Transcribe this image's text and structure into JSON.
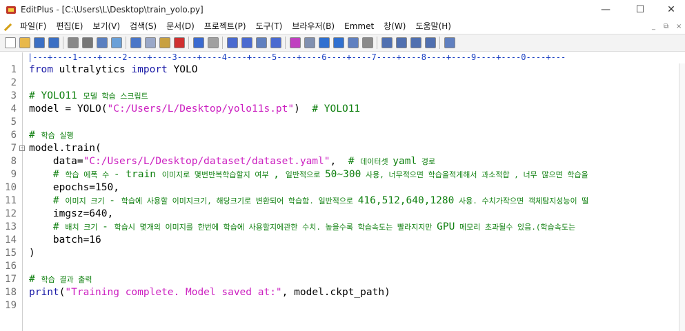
{
  "window": {
    "title": "EditPlus - [C:\\Users\\L\\Desktop\\train_yolo.py]",
    "minimize": "—",
    "maximize": "☐",
    "close": "✕"
  },
  "menu": {
    "items": [
      "파일(F)",
      "편집(E)",
      "보기(V)",
      "검색(S)",
      "문서(D)",
      "프로젝트(P)",
      "도구(T)",
      "브라우저(B)",
      "Emmet",
      "창(W)",
      "도움말(H)"
    ],
    "doc_min": "_",
    "doc_restore": "⧉",
    "doc_close": "×"
  },
  "toolbar": {
    "icons": [
      "new-file-icon",
      "open-folder-icon",
      "save-icon",
      "save-all-icon",
      "print-preview-icon",
      "print-icon",
      "spellcheck-icon",
      "browser-icon",
      "cut-icon",
      "copy-icon",
      "paste-icon",
      "delete-icon",
      "undo-icon",
      "redo-icon",
      "find-icon",
      "replace-icon",
      "goto-icon",
      "indent-icon",
      "font-icon",
      "hex-icon",
      "wordwrap-icon",
      "line-number-icon",
      "column-icon",
      "settings-icon",
      "window-tile-icon",
      "window-cascade-icon",
      "window-split-icon",
      "window-full-icon",
      "help-icon"
    ]
  },
  "ruler": "|---+----1----+----2----+----3----+----4----+----5----+----6----+----7----+----8----+----9----+----0----+---",
  "colors": {
    "keyword": "#1a1aa6",
    "string": "#cc20c0",
    "comment": "#108010",
    "ruler": "#1a3fc2"
  },
  "lines": [
    {
      "n": "1",
      "tokens": [
        {
          "t": "from",
          "c": "kw"
        },
        {
          "t": " ultralytics ",
          "c": "id"
        },
        {
          "t": "import",
          "c": "kw"
        },
        {
          "t": " YOLO",
          "c": "id"
        }
      ]
    },
    {
      "n": "2",
      "tokens": []
    },
    {
      "n": "3",
      "tokens": [
        {
          "t": "# YOLO11 ",
          "c": "cm"
        },
        {
          "t": "모델 학습 스크립트",
          "c": "cm cm-k"
        }
      ]
    },
    {
      "n": "4",
      "tokens": [
        {
          "t": "model = YOLO(",
          "c": "id"
        },
        {
          "t": "\"C:/Users/L/Desktop/yolo11s.pt\"",
          "c": "str"
        },
        {
          "t": ")  ",
          "c": "id"
        },
        {
          "t": "# YOLO11",
          "c": "cm"
        }
      ]
    },
    {
      "n": "5",
      "tokens": []
    },
    {
      "n": "6",
      "tokens": [
        {
          "t": "# ",
          "c": "cm"
        },
        {
          "t": "학습 실행",
          "c": "cm cm-k"
        }
      ]
    },
    {
      "n": "7",
      "fold": true,
      "tokens": [
        {
          "t": "model.train(",
          "c": "id"
        }
      ]
    },
    {
      "n": "8",
      "tokens": [
        {
          "t": "    data=",
          "c": "id"
        },
        {
          "t": "\"C:/Users/L/Desktop/dataset/dataset.yaml\"",
          "c": "str"
        },
        {
          "t": ",  ",
          "c": "id"
        },
        {
          "t": "# ",
          "c": "cm"
        },
        {
          "t": "데이터셋 ",
          "c": "cm cm-k"
        },
        {
          "t": "yaml",
          "c": "cm"
        },
        {
          "t": " 경로",
          "c": "cm cm-k"
        }
      ]
    },
    {
      "n": "9",
      "tokens": [
        {
          "t": "    # ",
          "c": "cm"
        },
        {
          "t": "학습 에폭 수 ",
          "c": "cm cm-k"
        },
        {
          "t": "- train ",
          "c": "cm"
        },
        {
          "t": "이미지로 몇번반복학습할지 여부 ",
          "c": "cm cm-k"
        },
        {
          "t": ", ",
          "c": "cm"
        },
        {
          "t": "일반적으로 ",
          "c": "cm cm-k"
        },
        {
          "t": "50~300",
          "c": "cm"
        },
        {
          "t": " 사용, 너무적으면 학습을적게해서 과소적합 , 너무 많으면 학습을",
          "c": "cm cm-k"
        }
      ]
    },
    {
      "n": "10",
      "tokens": [
        {
          "t": "    epochs=150,",
          "c": "id"
        }
      ]
    },
    {
      "n": "11",
      "tokens": [
        {
          "t": "    # ",
          "c": "cm"
        },
        {
          "t": "이미지 크기 ",
          "c": "cm cm-k"
        },
        {
          "t": "- ",
          "c": "cm"
        },
        {
          "t": "학습에 사용할 이미지크기, 해당크기로 변환되어 학습함. 일반적으로 ",
          "c": "cm cm-k"
        },
        {
          "t": "416,512,640,1280",
          "c": "cm"
        },
        {
          "t": " 사용. 수치가작으면 객체탐지성능이 떨",
          "c": "cm cm-k"
        }
      ]
    },
    {
      "n": "12",
      "tokens": [
        {
          "t": "    imgsz=640,",
          "c": "id"
        }
      ]
    },
    {
      "n": "13",
      "tokens": [
        {
          "t": "    # ",
          "c": "cm"
        },
        {
          "t": "배치 크기 ",
          "c": "cm cm-k"
        },
        {
          "t": "- ",
          "c": "cm"
        },
        {
          "t": "학습시 몇개의 이미지를 한번에 학습에 사용할지에관한 수치. 높을수록 학습속도는 빨라지지만 ",
          "c": "cm cm-k"
        },
        {
          "t": "GPU",
          "c": "cm"
        },
        {
          "t": " 메모리 초과될수 있음.(학습속도는",
          "c": "cm cm-k"
        }
      ]
    },
    {
      "n": "14",
      "tokens": [
        {
          "t": "    batch=16",
          "c": "id"
        }
      ]
    },
    {
      "n": "15",
      "tokens": [
        {
          "t": ")",
          "c": "id"
        }
      ]
    },
    {
      "n": "16",
      "tokens": []
    },
    {
      "n": "17",
      "tokens": [
        {
          "t": "# ",
          "c": "cm"
        },
        {
          "t": "학습 결과 출력",
          "c": "cm cm-k"
        }
      ]
    },
    {
      "n": "18",
      "tokens": [
        {
          "t": "print",
          "c": "kw"
        },
        {
          "t": "(",
          "c": "id"
        },
        {
          "t": "\"Training complete. Model saved at:\"",
          "c": "str"
        },
        {
          "t": ", model.ckpt_path)",
          "c": "id"
        }
      ]
    },
    {
      "n": "19",
      "tokens": []
    }
  ]
}
